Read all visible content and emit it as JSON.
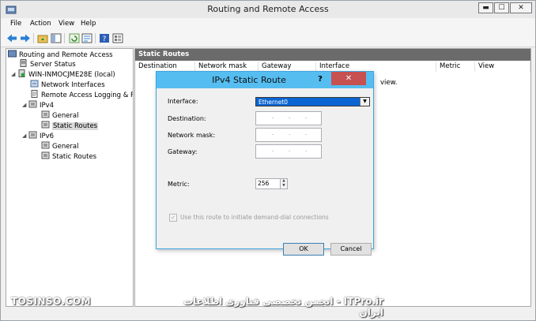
{
  "window": {
    "title": "Routing and Remote Access",
    "min_glyph": "▬",
    "max_glyph": "☐",
    "close_glyph": "✕"
  },
  "menu": [
    "File",
    "Action",
    "View",
    "Help"
  ],
  "tree": {
    "items": [
      {
        "label": "Routing and Remote Access",
        "expand": ""
      },
      {
        "label": "Server Status",
        "expand": ""
      },
      {
        "label": "WIN-INMOCJME28E (local)",
        "expand": "◢"
      },
      {
        "label": "Network Interfaces",
        "expand": ""
      },
      {
        "label": "Remote Access Logging & Pol",
        "expand": ""
      },
      {
        "label": "IPv4",
        "expand": "◢"
      },
      {
        "label": "General",
        "expand": ""
      },
      {
        "label": "Static Routes",
        "expand": ""
      },
      {
        "label": "IPv6",
        "expand": "◢"
      },
      {
        "label": "General",
        "expand": ""
      },
      {
        "label": "Static Routes",
        "expand": ""
      }
    ]
  },
  "content": {
    "header": "Static Routes",
    "columns": [
      "Destination",
      "Network mask",
      "Gateway",
      "Interface",
      "Metric",
      "View"
    ],
    "empty_msg": "view."
  },
  "dialog": {
    "title": "IPv4 Static Route",
    "help": "?",
    "close": "✕",
    "labels": {
      "interface": "Interface:",
      "destination": "Destination:",
      "mask": "Network mask:",
      "gateway": "Gateway:",
      "metric": "Metric:"
    },
    "interface_value": "Ethernet0",
    "ip_dot": ".",
    "metric_value": "256",
    "checkbox_label": "Use this route to initiate demand-dial connections",
    "checkbox_mark": "✓",
    "ok": "OK",
    "cancel": "Cancel"
  },
  "watermark": {
    "left": "TOSINSO.COM",
    "right": "ITPro.ir - انجمن تخصصی فناوری اطلاعات ایران"
  },
  "colors": {
    "dialog_title": "#56bdf0",
    "close_red": "#c75050",
    "selection_blue": "#0a64d2",
    "content_header": "#6b6b6b"
  }
}
